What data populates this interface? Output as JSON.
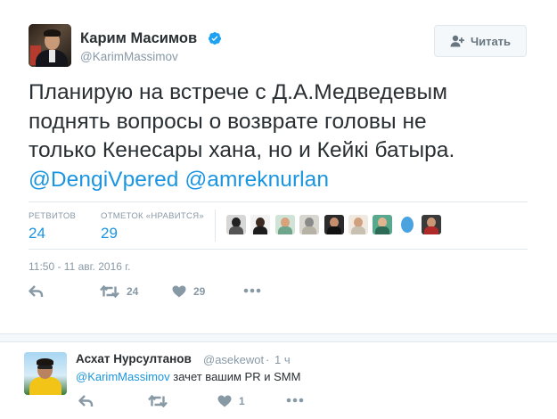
{
  "tweet": {
    "author_name": "Карим Масимов",
    "author_handle": "@KarimMassimov",
    "follow_label": "Читать",
    "text_lines": [
      "Планирую на встрече с Д.А.Медведевым",
      "поднять вопросы о возврате головы не",
      "только Кенесары хана, но и Кейкі батыра."
    ],
    "mentions": [
      "@DengiVpered",
      "@amreknurlan"
    ],
    "stats": {
      "retweets_label": "РЕТВИТОВ",
      "retweets_count": "24",
      "likes_label": "ОТМЕТОК «НРАВИТСЯ»",
      "likes_count": "29"
    },
    "timestamp": "11:50 - 11 авг. 2016 г.",
    "actions": {
      "retweet_count": "24",
      "like_count": "29"
    }
  },
  "reply": {
    "author_name": "Асхат Нурсултанов",
    "author_handle": "@asekewot",
    "separator": "·",
    "time": "1 ч",
    "mention": "@KarimMassimov",
    "text": " зачет вашим PR и SMM",
    "actions": {
      "like_count": "1"
    }
  },
  "colors": {
    "link": "#1b95e0",
    "muted": "#8899a6",
    "text": "#292f33",
    "verified": "#1da1f2"
  }
}
